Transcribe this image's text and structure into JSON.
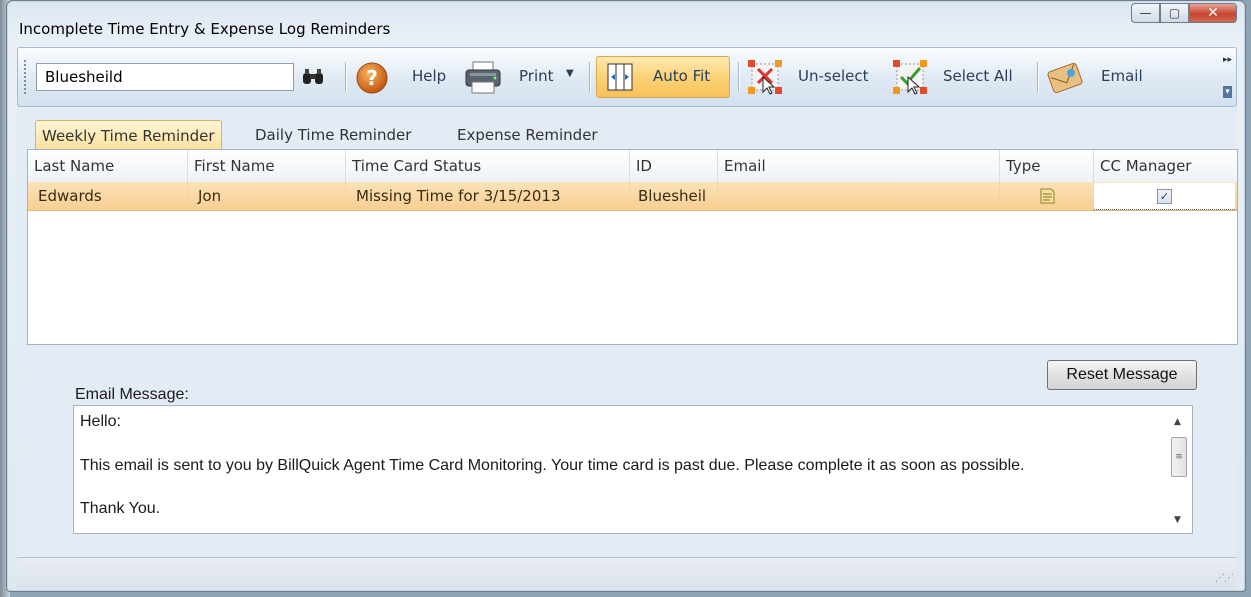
{
  "window": {
    "title": "Incomplete Time Entry & Expense Log Reminders",
    "minimize": "—",
    "maximize": "▢",
    "close": "✕"
  },
  "toolbar": {
    "search_value": "Bluesheild",
    "help_label": "Help",
    "print_label": "Print",
    "autofit_label": "Auto Fit",
    "unselect_label": "Un-select",
    "selectall_label": "Select All",
    "email_label": "Email",
    "icons": {
      "search": "binoculars-icon",
      "help": "help-icon",
      "print": "printer-icon",
      "autofit": "auto-fit-icon",
      "unselect": "unselect-icon",
      "selectall": "select-all-icon",
      "email": "email-icon"
    }
  },
  "tabs": [
    {
      "label": "Weekly Time Reminder",
      "active": true
    },
    {
      "label": "Daily Time Reminder",
      "active": false
    },
    {
      "label": "Expense Reminder",
      "active": false
    }
  ],
  "grid": {
    "columns": [
      "Last Name",
      "First Name",
      "Time Card Status",
      "ID",
      "Email",
      "Type",
      "CC Manager"
    ],
    "rows": [
      {
        "last_name": "Edwards",
        "first_name": "Jon",
        "status": "Missing Time for 3/15/2013",
        "id": "Bluesheil",
        "email": "",
        "type_icon": "document-icon",
        "cc_manager": true
      }
    ]
  },
  "message": {
    "label": "Email Message:",
    "reset_label": "Reset Message",
    "lines": [
      "Hello:",
      "This email is sent to you by BillQuick Agent Time Card Monitoring. Your time card is past due. Please complete it as soon as possible.",
      "Thank You."
    ]
  },
  "colors": {
    "selected_row": "#f7cf92",
    "active_tab": "#fbe09a",
    "close_button": "#c7442d"
  }
}
